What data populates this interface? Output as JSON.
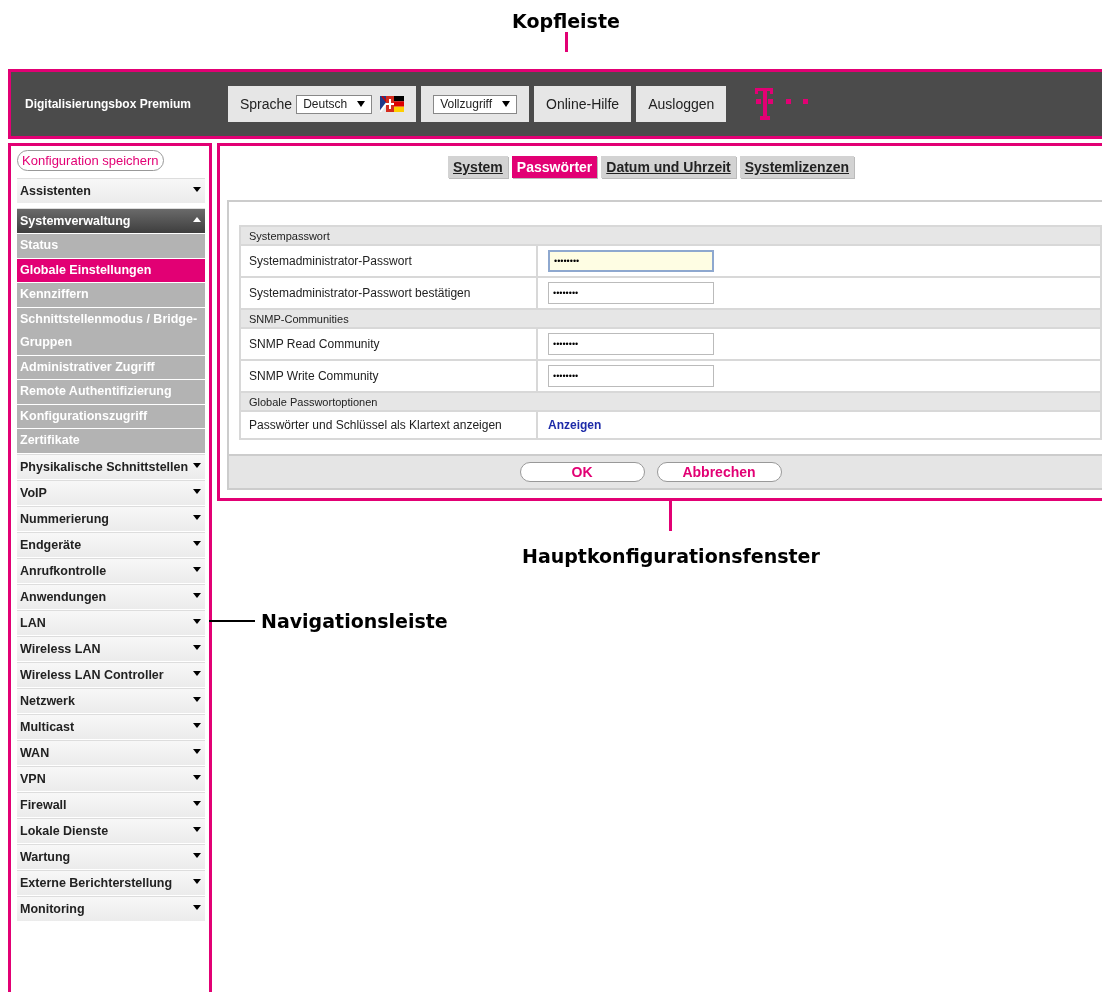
{
  "annotations": {
    "header": "Kopfleiste",
    "main": "Hauptkonfigurationsfenster",
    "navigation": "Navigationsleiste"
  },
  "header": {
    "product": "Digitalisierungsbox Premium",
    "language_label": "Sprache",
    "language": "Deutsch",
    "access": "Vollzugriff",
    "help": "Online-Hilfe",
    "logout": "Ausloggen"
  },
  "sidebar": {
    "save_button": "Konfiguration speichern",
    "items": [
      {
        "label": "Assistenten",
        "expanded": false
      },
      {
        "label": "Systemverwaltung",
        "expanded": true,
        "children": [
          {
            "label": "Status",
            "selected": false
          },
          {
            "label": "Globale Einstellungen",
            "selected": true
          },
          {
            "label": "Kennziffern",
            "selected": false
          },
          {
            "label": "Schnittstellenmodus / Bridge-Gruppen",
            "selected": false
          },
          {
            "label": "Administrativer Zugriff",
            "selected": false
          },
          {
            "label": "Remote Authentifizierung",
            "selected": false
          },
          {
            "label": "Konfigurationszugriff",
            "selected": false
          },
          {
            "label": "Zertifikate",
            "selected": false
          }
        ]
      },
      {
        "label": "Physikalische Schnittstellen",
        "expanded": false
      },
      {
        "label": "VoIP",
        "expanded": false
      },
      {
        "label": "Nummerierung",
        "expanded": false
      },
      {
        "label": "Endgeräte",
        "expanded": false
      },
      {
        "label": "Anrufkontrolle",
        "expanded": false
      },
      {
        "label": "Anwendungen",
        "expanded": false
      },
      {
        "label": "LAN",
        "expanded": false
      },
      {
        "label": "Wireless LAN",
        "expanded": false
      },
      {
        "label": "Wireless LAN Controller",
        "expanded": false
      },
      {
        "label": "Netzwerk",
        "expanded": false
      },
      {
        "label": "Multicast",
        "expanded": false
      },
      {
        "label": "WAN",
        "expanded": false
      },
      {
        "label": "VPN",
        "expanded": false
      },
      {
        "label": "Firewall",
        "expanded": false
      },
      {
        "label": "Lokale Dienste",
        "expanded": false
      },
      {
        "label": "Wartung",
        "expanded": false
      },
      {
        "label": "Externe Berichterstellung",
        "expanded": false
      },
      {
        "label": "Monitoring",
        "expanded": false
      }
    ]
  },
  "tabs": [
    {
      "label": "System",
      "selected": false
    },
    {
      "label": "Passwörter",
      "selected": true
    },
    {
      "label": "Datum und Uhrzeit",
      "selected": false
    },
    {
      "label": "Systemlizenzen",
      "selected": false
    }
  ],
  "sections": [
    {
      "title": "Systempasswort",
      "rows": [
        {
          "kind": "password",
          "label": "Systemadministrator-Passwort",
          "value": "••••••••",
          "focused": true
        },
        {
          "kind": "password",
          "label": "Systemadministrator-Passwort bestätigen",
          "value": "••••••••",
          "focused": false
        }
      ]
    },
    {
      "title": "SNMP-Communities",
      "rows": [
        {
          "kind": "password",
          "label": "SNMP Read Community",
          "value": "••••••••",
          "focused": false
        },
        {
          "kind": "password",
          "label": "SNMP Write Community",
          "value": "••••••••",
          "focused": false
        }
      ]
    },
    {
      "title": "Globale Passwortoptionen",
      "rows": [
        {
          "kind": "link",
          "label": "Passwörter und Schlüssel als Klartext anzeigen",
          "value": "Anzeigen"
        }
      ]
    }
  ],
  "buttons": [
    "OK",
    "Abbrechen"
  ]
}
